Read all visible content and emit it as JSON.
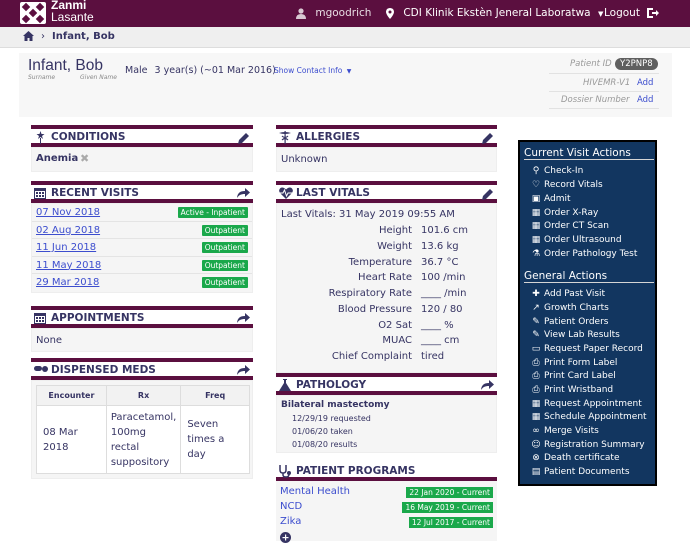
{
  "app": {
    "logo_line1": "Zanmi",
    "logo_line2": "Lasante",
    "user": "mgoodrich",
    "location": "CDI Klinik Ekstèn Jeneral Laboratwa",
    "logout": "Logout"
  },
  "breadcrumb": {
    "patient": "Infant, Bob"
  },
  "patient": {
    "name": "Infant, Bob",
    "surname_label": "Surname",
    "given_label": "Given Name",
    "gender": "Male",
    "age": "3 year(s) (~01 Mar 2016)",
    "show_contact": "Show Contact Info",
    "patient_id_label": "Patient ID",
    "patient_id": "Y2PNP8",
    "hivemr_label": "HIVEMR-V1",
    "dossier_label": "Dossier Number",
    "add_label": "Add"
  },
  "conditions": {
    "title": "CONDITIONS",
    "items": [
      "Anemia"
    ]
  },
  "recent_visits": {
    "title": "RECENT VISITS",
    "items": [
      {
        "date": "07 Nov 2018",
        "status": "Active - Inpatient"
      },
      {
        "date": "02 Aug 2018",
        "status": "Outpatient"
      },
      {
        "date": "11 Jun 2018",
        "status": "Outpatient"
      },
      {
        "date": "11 May 2018",
        "status": "Outpatient"
      },
      {
        "date": "29 Mar 2018",
        "status": "Outpatient"
      }
    ]
  },
  "appointments": {
    "title": "APPOINTMENTS",
    "value": "None"
  },
  "dispensed_meds": {
    "title": "DISPENSED MEDS",
    "headers": [
      "Encounter",
      "Rx",
      "Freq"
    ],
    "row": {
      "encounter": "08 Mar 2018",
      "rx": "Paracetamol, 100mg rectal suppository",
      "freq": "Seven times a day"
    }
  },
  "allergies": {
    "title": "ALLERGIES",
    "value": "Unknown"
  },
  "last_vitals": {
    "title": "LAST VITALS",
    "summary": "Last Vitals: 31 May 2019 09:55 AM",
    "rows": [
      {
        "label": "Height",
        "value": "101.6 cm"
      },
      {
        "label": "Weight",
        "value": "13.6 kg"
      },
      {
        "label": "Temperature",
        "value": "36.7 °C"
      },
      {
        "label": "Heart Rate",
        "value": "100 /min"
      },
      {
        "label": "Respiratory Rate",
        "value": "____ /min"
      },
      {
        "label": "Blood Pressure",
        "value": "120 / 80"
      },
      {
        "label": "O2 Sat",
        "value": "____ %"
      },
      {
        "label": "MUAC",
        "value": "____  cm"
      },
      {
        "label": "Chief Complaint",
        "value": "tired"
      }
    ]
  },
  "pathology": {
    "title": "PATHOLOGY",
    "test": "Bilateral mastectomy",
    "lines": [
      "12/29/19 requested",
      "01/06/20 taken",
      "01/08/20 results"
    ]
  },
  "patient_programs": {
    "title": "PATIENT PROGRAMS",
    "items": [
      {
        "name": "Mental Health",
        "date": "22 Jan 2020 - Current"
      },
      {
        "name": "NCD",
        "date": "16 May 2019 - Current"
      },
      {
        "name": "Zika",
        "date": "12 Jul 2017 - Current"
      }
    ]
  },
  "current_visit_actions": {
    "title": "Current Visit Actions",
    "items": [
      "Check-In",
      "Record Vitals",
      "Admit",
      "Order X-Ray",
      "Order CT Scan",
      "Order Ultrasound",
      "Order Pathology Test"
    ]
  },
  "general_actions": {
    "title": "General Actions",
    "items": [
      "Add Past Visit",
      "Growth Charts",
      "Patient Orders",
      "View Lab Results",
      "Request Paper Record",
      "Print Form Label",
      "Print Card Label",
      "Print Wristband",
      "Request Appointment",
      "Schedule Appointment",
      "Merge Visits",
      "Registration Summary",
      "Death certificate",
      "Patient Documents"
    ]
  }
}
